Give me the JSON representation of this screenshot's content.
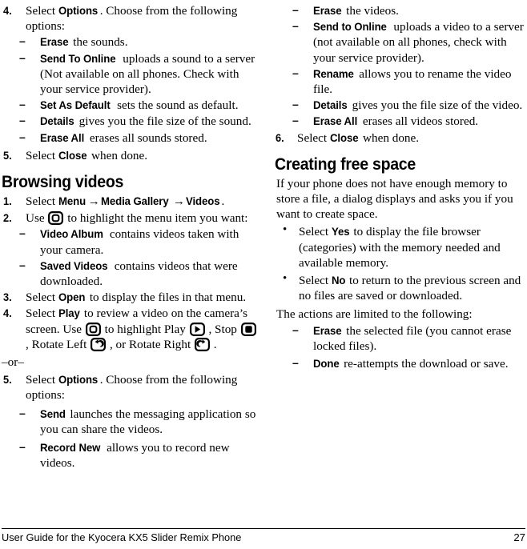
{
  "footer": {
    "text": "User Guide for the Kyocera KX5 Slider Remix Phone",
    "page_number": "27"
  },
  "icons": {
    "navigation_key": "navigation-key-icon",
    "play": "play-icon",
    "stop": "stop-icon",
    "rotate_left": "rotate-left-icon",
    "rotate_right": "rotate-right-icon"
  },
  "left_column": {
    "sounds_step4": {
      "num": "4.",
      "text_1": "Select",
      "term_options": "Options",
      "text_2": ". Choose from the following options:"
    },
    "sounds_options": [
      {
        "dash": "–",
        "term": "Erase",
        "text": " the sounds."
      },
      {
        "dash": "–",
        "term": "Send To Online",
        "text": " uploads a sound to a server (Not available on all phones. Check with your service provider)."
      },
      {
        "dash": "–",
        "term": "Set As Default",
        "text": " sets the sound as default."
      },
      {
        "dash": "–",
        "term": "Details",
        "text": " gives you the file size of the sound."
      },
      {
        "dash": "–",
        "term": "Erase All",
        "text": " erases all sounds stored."
      }
    ],
    "sounds_step5": {
      "num": "5.",
      "text_1": "Select",
      "term_close": "Close",
      "text_2": " when done."
    },
    "browsing_heading": "Browsing videos",
    "browse_step1": {
      "num": "1.",
      "text_1": "Select",
      "term_menu": "Menu",
      "arrow_1": "→",
      "term_media_gallery": "Media Gallery",
      "arrow_2": "→",
      "term_videos": "Videos",
      "text_2": "."
    },
    "browse_step2": {
      "num": "2.",
      "text_1": "Use",
      "text_2": "to highlight the menu item you want:"
    },
    "browse_menu_items": [
      {
        "dash": "–",
        "term": "Video Album",
        "text": " contains videos taken with your camera."
      },
      {
        "dash": "–",
        "term": "Saved Videos",
        "text": " contains videos that were downloaded."
      }
    ],
    "browse_step3": {
      "num": "3.",
      "text_1": "Select",
      "term_open": "Open",
      "text_2": " to display the files in that menu."
    },
    "browse_step4": {
      "num": "4.",
      "text_1": "Select",
      "term_play": "Play",
      "text_2": " to review a video on the camera’s screen. Use",
      "text_3": "to highlight Play",
      "text_4": ", Stop",
      "text_5": ", Rotate Left",
      "text_6": ", or Rotate Right",
      "text_7": "."
    },
    "or_separator": "–or–",
    "browse_step5": {
      "num": "5.",
      "text_1": "Select",
      "term_options": "Options",
      "text_2": ". Choose from the following options:"
    },
    "video_options_left": [
      {
        "dash": "–",
        "term": "Send",
        "text": " launches the messaging application so you can share the videos."
      },
      {
        "dash": "–",
        "term": "Record New",
        "text": " allows you to record new videos."
      }
    ]
  },
  "right_column": {
    "video_options_right": [
      {
        "dash": "–",
        "term": "Erase",
        "text": " the videos."
      },
      {
        "dash": "–",
        "term": "Send to Online",
        "text": " uploads a video to a server (not available on all phones, check with your service provider)."
      },
      {
        "dash": "–",
        "term": "Rename",
        "text": " allows you to rename the video file."
      },
      {
        "dash": "–",
        "term": "Details",
        "text": " gives you the file size of the video."
      },
      {
        "dash": "–",
        "term": "Erase All",
        "text": " erases all videos stored."
      }
    ],
    "video_step6": {
      "num": "6.",
      "text_1": "Select",
      "term_close": "Close",
      "text_2": " when done."
    },
    "free_space_heading": "Creating free space",
    "free_space_intro": "If your phone does not have enough memory to store a file, a dialog displays and asks you if you want to create space.",
    "free_space_bullets": [
      {
        "dot": "•",
        "text_1": "Select",
        "term": "Yes",
        "text_2": " to display the file browser (categories) with the memory needed and available memory."
      },
      {
        "dot": "•",
        "text_1": "Select",
        "term": "No",
        "text_2": " to return to the previous screen and no files are saved or downloaded."
      }
    ],
    "actions_intro": "The actions are limited to the following:",
    "actions": [
      {
        "dash": "–",
        "term": "Erase",
        "text": " the selected file (you cannot erase locked files)."
      },
      {
        "dash": "–",
        "term": "Done",
        "text": " re-attempts the download or save."
      }
    ]
  }
}
